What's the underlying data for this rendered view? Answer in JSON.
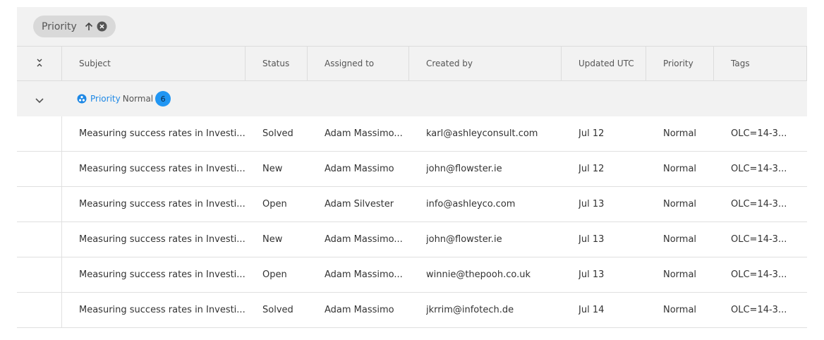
{
  "group_chip": {
    "label": "Priority"
  },
  "columns": [
    "Subject",
    "Status",
    "Assigned to",
    "Created by",
    "Updated UTC",
    "Priority",
    "Tags"
  ],
  "group": {
    "field": "Priority",
    "value": "Normal",
    "count": "6"
  },
  "rows": [
    {
      "subject": "Measuring success rates in Investi...",
      "status": "Solved",
      "assigned": "Adam Massimo...",
      "created": "karl@ashleyconsult.com",
      "updated": "Jul 12",
      "priority": "Normal",
      "tags": "OLC=14-3..."
    },
    {
      "subject": "Measuring success rates in Investi...",
      "status": "New",
      "assigned": "Adam Massimo",
      "created": "john@flowster.ie",
      "updated": "Jul 12",
      "priority": "Normal",
      "tags": "OLC=14-3..."
    },
    {
      "subject": "Measuring success rates in Investi...",
      "status": "Open",
      "assigned": "Adam Silvester",
      "created": "info@ashleyco.com",
      "updated": "Jul 13",
      "priority": "Normal",
      "tags": "OLC=14-3..."
    },
    {
      "subject": "Measuring success rates in Investi...",
      "status": "New",
      "assigned": "Adam Massimo...",
      "created": "john@flowster.ie",
      "updated": "Jul 13",
      "priority": "Normal",
      "tags": "OLC=14-3..."
    },
    {
      "subject": "Measuring success rates in Investi...",
      "status": "Open",
      "assigned": "Adam Massimo...",
      "created": "winnie@thepooh.co.uk",
      "updated": "Jul 13",
      "priority": "Normal",
      "tags": "OLC=14-3..."
    },
    {
      "subject": "Measuring success rates in Investi...",
      "status": "Solved",
      "assigned": "Adam Massimo",
      "created": "jkrrim@infotech.de",
      "updated": "Jul 14",
      "priority": "Normal",
      "tags": "OLC=14-3..."
    }
  ],
  "icons": {
    "sort": "arrow-up-icon",
    "remove": "close-circle-icon",
    "expand_all": "expand-collapse-icon",
    "group_toggle": "chevron-down-icon",
    "group_field": "group-icon"
  },
  "colors": {
    "accent": "#2196f3",
    "group_link": "#1e88e5"
  }
}
